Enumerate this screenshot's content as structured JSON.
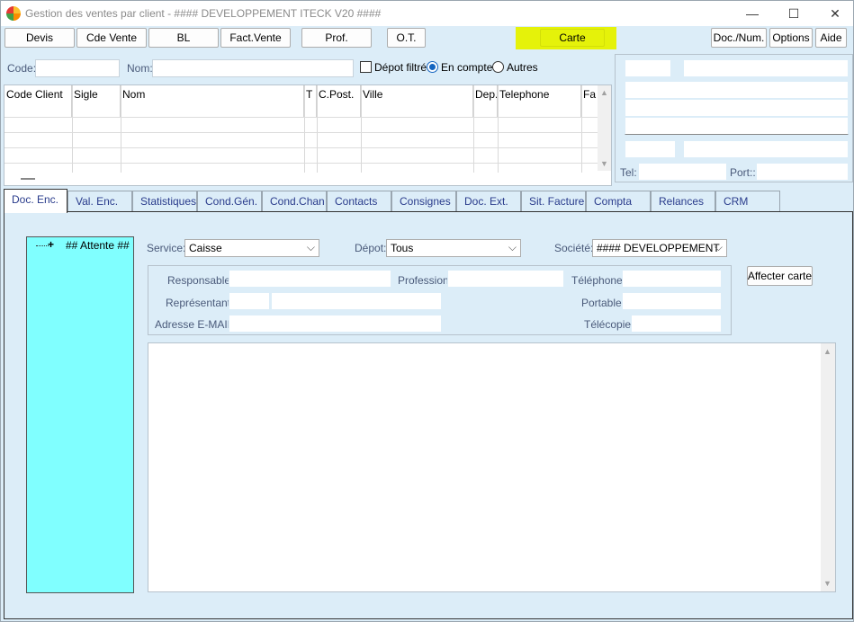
{
  "window": {
    "title": "Gestion des ventes par client - #### DEVELOPPEMENT ITECK V20 ####",
    "controls": [
      "—",
      "☐",
      "✕"
    ]
  },
  "toolbar": {
    "buttons": [
      "Devis",
      "Cde Vente",
      "BL",
      "Fact.Vente",
      "Prof.",
      "O.T."
    ],
    "carte": "Carte",
    "carte_highlight": "#e5f20a",
    "right_buttons": [
      "Doc./Num.",
      "Options",
      "Aide"
    ]
  },
  "search": {
    "code_label": "Code:",
    "code_value": "",
    "nom_label": "Nom:",
    "nom_value": "",
    "depot_filtre_label": "Dépot filtré",
    "depot_filtre_checked": false,
    "en_compte_label": "En compte",
    "autres_label": "Autres",
    "selected_radio": "En compte"
  },
  "grid": {
    "columns": [
      "Code Client",
      "Sigle",
      "Nom",
      "T",
      "C.Post.",
      "Ville",
      "Dep.",
      "Telephone",
      "Fa"
    ],
    "rows": []
  },
  "client_panel": {
    "tel_label": "Tel:",
    "tel_value": "",
    "port_label": "Port::",
    "port_value": ""
  },
  "tabs": [
    "Doc. Enc.",
    "Val. Enc.",
    "Statistiques",
    "Cond.Gén.",
    "Cond.Chan",
    "Contacts",
    "Consignes",
    "Doc. Ext.",
    "Sit. Facture",
    "Compta",
    "Relances",
    "CRM"
  ],
  "active_tab": "Doc. Enc.",
  "tree": {
    "root_label": "## Attente ##",
    "expander": "+",
    "bg_color": "#80ffff"
  },
  "filters": {
    "service_label": "Service:",
    "service_value": "Caisse",
    "depot_label": "Dépot:",
    "depot_value": "Tous",
    "societe_label": "Société:",
    "societe_value": "#### DEVELOPPEMENT"
  },
  "contact_box": {
    "responsable_label": "Responsable:",
    "profession_label": "Profession:",
    "telephone_label": "Téléphone:",
    "representant_label": "Représentant:",
    "portable_label": "Portable:",
    "email_label": "Adresse E-MAIL:",
    "telecopie_label": "Télécopie:"
  },
  "affecter_carte": "Affecter carte"
}
